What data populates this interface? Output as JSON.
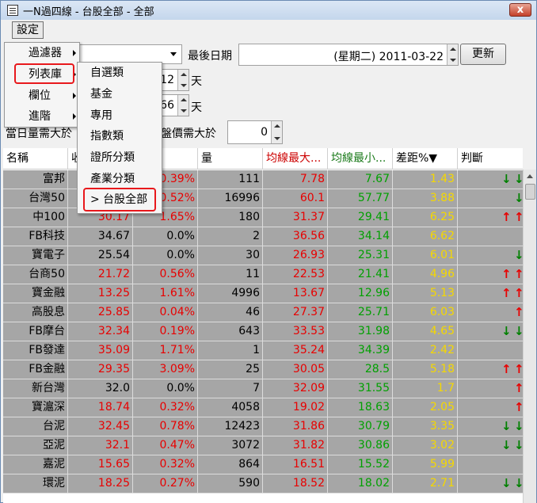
{
  "window": {
    "title": "一N過四線 - 台股全部 - 全部",
    "close": "x"
  },
  "menubar": {
    "settings": "設定"
  },
  "toolbar": {
    "last_date_label": "最後日期",
    "date_value": "(星期二) 2011-03-22",
    "refresh_button": "更新",
    "field1_value": "12",
    "field1_unit": "天",
    "field2_value": "66",
    "field2_unit": "天",
    "volume_label": "當日量需大於",
    "price_label": "收盤價需大於",
    "price_value": "0"
  },
  "menu1": {
    "items": [
      {
        "label": "過濾器"
      },
      {
        "label": "列表庫"
      },
      {
        "label": "欄位"
      },
      {
        "label": "進階"
      }
    ]
  },
  "menu2": {
    "items": [
      {
        "label": "自選類"
      },
      {
        "label": "基金"
      },
      {
        "label": "專用"
      },
      {
        "label": "指數類"
      },
      {
        "label": "證所分類"
      },
      {
        "label": "產業分類"
      },
      {
        "label": "> 台股全部"
      }
    ]
  },
  "grid": {
    "headers": [
      "名稱",
      "收",
      "幅",
      "量",
      "均線最大...",
      "均線最小...",
      "差距%▼",
      "判斷"
    ],
    "colors": {
      "up": "#e80000",
      "down": "#008000",
      "gap": "#f5d800",
      "row_bg": "#a6a6a6"
    },
    "rows": [
      {
        "name": "富邦",
        "close": "",
        "pct": "0.39%",
        "vol": "111",
        "max": "7.78",
        "min": "7.67",
        "gap": "1.43",
        "judge": [
          "down",
          "down"
        ]
      },
      {
        "name": "台灣50",
        "close": "",
        "pct": "0.52%",
        "vol": "16996",
        "max": "60.1",
        "min": "57.77",
        "gap": "3.88",
        "judge": [
          "",
          "down"
        ]
      },
      {
        "name": "中100",
        "close": "30.17",
        "pct": "1.65%",
        "vol": "180",
        "max": "31.37",
        "min": "29.41",
        "gap": "6.25",
        "judge": [
          "up",
          "up"
        ]
      },
      {
        "name": "FB科技",
        "close": "34.67",
        "pct": "0.0%",
        "vol": "2",
        "max": "36.56",
        "min": "34.14",
        "gap": "6.62",
        "judge": [
          "",
          ""
        ]
      },
      {
        "name": "寶電子",
        "close": "25.54",
        "pct": "0.0%",
        "vol": "30",
        "max": "26.93",
        "min": "25.31",
        "gap": "6.01",
        "judge": [
          "",
          "down"
        ]
      },
      {
        "name": "台商50",
        "close": "21.72",
        "pct": "0.56%",
        "vol": "11",
        "max": "22.53",
        "min": "21.41",
        "gap": "4.96",
        "judge": [
          "up",
          "up"
        ]
      },
      {
        "name": "寶金融",
        "close": "13.25",
        "pct": "1.61%",
        "vol": "4996",
        "max": "13.67",
        "min": "12.96",
        "gap": "5.13",
        "judge": [
          "up",
          "up"
        ]
      },
      {
        "name": "高股息",
        "close": "25.85",
        "pct": "0.04%",
        "vol": "46",
        "max": "27.37",
        "min": "25.71",
        "gap": "6.03",
        "judge": [
          "",
          "up"
        ]
      },
      {
        "name": "FB摩台",
        "close": "32.34",
        "pct": "0.19%",
        "vol": "643",
        "max": "33.53",
        "min": "31.98",
        "gap": "4.65",
        "judge": [
          "down",
          "down"
        ]
      },
      {
        "name": "FB發達",
        "close": "35.09",
        "pct": "1.71%",
        "vol": "1",
        "max": "35.24",
        "min": "34.39",
        "gap": "2.42",
        "judge": [
          "",
          ""
        ]
      },
      {
        "name": "FB金融",
        "close": "29.35",
        "pct": "3.09%",
        "vol": "25",
        "max": "30.05",
        "min": "28.5",
        "gap": "5.18",
        "judge": [
          "up",
          "up"
        ]
      },
      {
        "name": "新台灣",
        "close": "32.0",
        "pct": "0.0%",
        "vol": "7",
        "max": "32.09",
        "min": "31.55",
        "gap": "1.7",
        "judge": [
          "",
          "up"
        ]
      },
      {
        "name": "寶滬深",
        "close": "18.74",
        "pct": "0.32%",
        "vol": "4058",
        "max": "19.02",
        "min": "18.63",
        "gap": "2.05",
        "judge": [
          "",
          "up"
        ]
      },
      {
        "name": "台泥",
        "close": "32.45",
        "pct": "0.78%",
        "vol": "12423",
        "max": "31.86",
        "min": "30.79",
        "gap": "3.35",
        "judge": [
          "down",
          "down"
        ]
      },
      {
        "name": "亞泥",
        "close": "32.1",
        "pct": "0.47%",
        "vol": "3072",
        "max": "31.82",
        "min": "30.86",
        "gap": "3.02",
        "judge": [
          "down",
          "down"
        ]
      },
      {
        "name": "嘉泥",
        "close": "15.65",
        "pct": "0.32%",
        "vol": "864",
        "max": "16.51",
        "min": "15.52",
        "gap": "5.99",
        "judge": [
          "",
          ""
        ]
      },
      {
        "name": "環泥",
        "close": "18.25",
        "pct": "0.27%",
        "vol": "590",
        "max": "18.52",
        "min": "18.02",
        "gap": "2.71",
        "judge": [
          "down",
          "down"
        ]
      }
    ]
  }
}
